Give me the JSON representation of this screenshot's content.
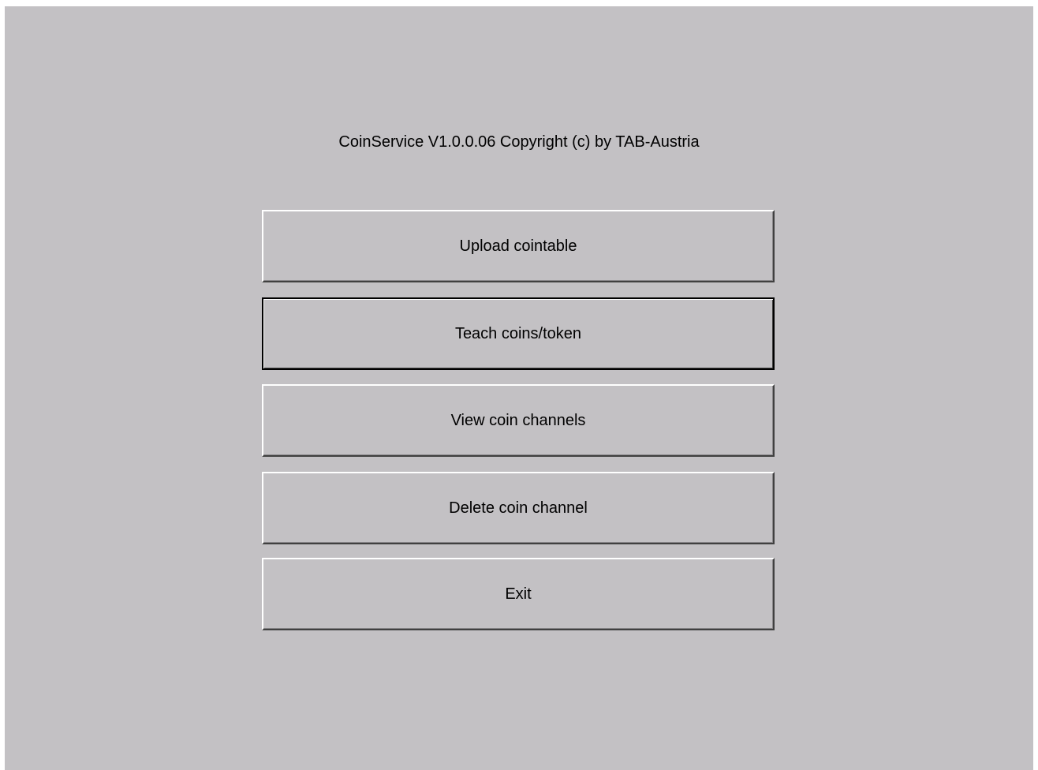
{
  "window": {
    "title": "CoinService V1.0.0.06 Copyright (c) by TAB-Austria",
    "background_color": "#c3c1c4"
  },
  "menu": {
    "buttons": [
      {
        "label": "Upload cointable"
      },
      {
        "label": "Teach coins/token",
        "focused": true
      },
      {
        "label": "View coin channels"
      },
      {
        "label": "Delete coin channel"
      },
      {
        "label": "Exit"
      }
    ]
  }
}
